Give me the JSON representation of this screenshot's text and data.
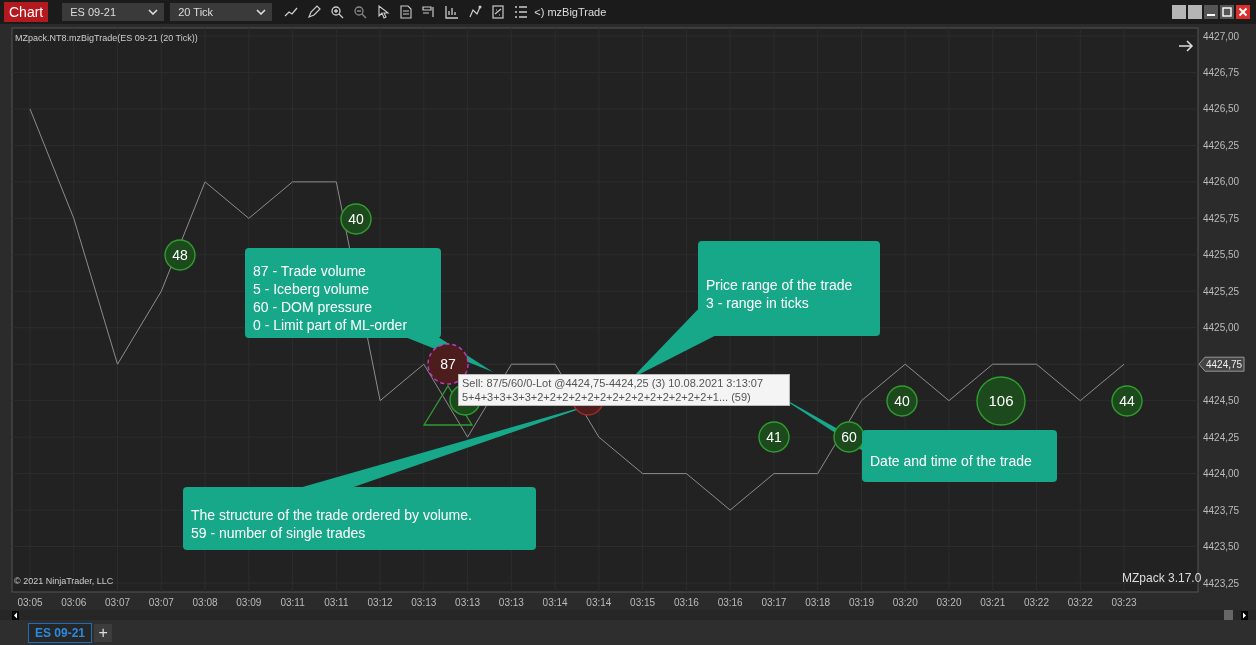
{
  "toolbar": {
    "title": "Chart",
    "instrument": "ES 09-21",
    "interval": "20 Tick",
    "indicator_button": "<) mzBigTrade"
  },
  "indicator_label": "MZpack.NT8.mzBigTrade(ES 09-21 (20 Tick))",
  "chart_data": {
    "type": "line",
    "categories": [
      "03:05",
      "03:06",
      "03:07",
      "03:07",
      "03:08",
      "03:09",
      "03:11",
      "03:11",
      "03:12",
      "03:13",
      "03:13",
      "03:13",
      "03:14",
      "03:14",
      "03:15",
      "03:16",
      "03:16",
      "03:17",
      "03:18",
      "03:19",
      "03:20",
      "03:20",
      "03:21",
      "03:22",
      "03:22",
      "03:23"
    ],
    "ylim": [
      4423.25,
      4427
    ],
    "yticks": [
      {
        "value": 4427,
        "label": "4427,00"
      },
      {
        "value": 4426.75,
        "label": "4426,75"
      },
      {
        "value": 4426.5,
        "label": "4426,50"
      },
      {
        "value": 4426.25,
        "label": "4426,25"
      },
      {
        "value": 4426,
        "label": "4426,00"
      },
      {
        "value": 4425.75,
        "label": "4425,75"
      },
      {
        "value": 4425.5,
        "label": "4425,50"
      },
      {
        "value": 4425.25,
        "label": "4425,25"
      },
      {
        "value": 4425,
        "label": "4425,00"
      },
      {
        "value": 4424.75,
        "label": "4424,75"
      },
      {
        "value": 4424.5,
        "label": "4424,50"
      },
      {
        "value": 4424.25,
        "label": "4424,25"
      },
      {
        "value": 4424,
        "label": "4424,00"
      },
      {
        "value": 4423.75,
        "label": "4423,75"
      },
      {
        "value": 4423.5,
        "label": "4423,50"
      },
      {
        "value": 4423.25,
        "label": "4423,25"
      }
    ],
    "grid": true,
    "series": [
      {
        "color": "#8c8c8c",
        "values": [
          4426.5,
          4425.75,
          4424.75,
          4425.25,
          4426,
          4425.75,
          4426,
          4426,
          4424.5,
          4424.75,
          4424.25,
          4424.75,
          4424.75,
          4424.25,
          4424,
          4424,
          4423.75,
          4424,
          4424,
          4424.5,
          4424.75,
          4424.5,
          4424.75,
          4424.75,
          4424.5,
          4424.75
        ]
      }
    ]
  },
  "bubbles": [
    {
      "label": "48",
      "kind": "buy",
      "highlighted": false
    },
    {
      "label": "40",
      "kind": "buy",
      "highlighted": false
    },
    {
      "label": "87",
      "kind": "sell",
      "highlighted": true
    },
    {
      "kind": "buy",
      "highlighted": false
    },
    {
      "kind": "sell",
      "highlighted": false
    },
    {
      "label": "41",
      "kind": "buy",
      "highlighted": false
    },
    {
      "label": "60",
      "kind": "buy",
      "highlighted": false
    },
    {
      "label": "40",
      "kind": "buy",
      "highlighted": false
    },
    {
      "label": "106",
      "kind": "buy",
      "highlighted": false
    },
    {
      "label": "44",
      "kind": "buy",
      "highlighted": false
    }
  ],
  "tooltip": {
    "lines": [
      "Sell: 87/5/60/0-Lot  @4424,75-4424,25  (3)  10.08.2021  3:13:07",
      "5+4+3+3+3+3+2+2+2+2+2+2+2+2+2+2+2+2+2+2+1... (59)"
    ]
  },
  "callouts": [
    {
      "lines": [
        "87 - Trade volume",
        "5 - Iceberg volume",
        "60 - DOM pressure",
        "0 - Limit part of ML-order"
      ]
    },
    {
      "lines": [
        "Price range of the trade",
        "3 - range in ticks"
      ]
    },
    {
      "lines": [
        "The structure of the trade ordered by volume.",
        "59 - number of single trades"
      ]
    },
    {
      "lines": [
        "Date and time of the trade"
      ]
    }
  ],
  "copyright": "© 2021 NinjaTrader, LLC",
  "version": "MZpack 3.17.0",
  "tabs": [
    {
      "label": "ES 09-21",
      "selected": true
    }
  ],
  "add_tab": "+"
}
